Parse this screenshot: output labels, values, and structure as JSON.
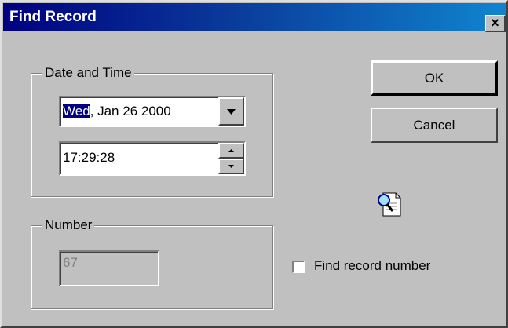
{
  "window": {
    "title": "Find Record",
    "close_glyph": "✕"
  },
  "date_time_group": {
    "legend": "Date and Time",
    "date": {
      "weekday_selected": "Wed",
      "rest": ", Jan 26 2000"
    },
    "time": {
      "value": "17:29:28"
    }
  },
  "number_group": {
    "legend": "Number",
    "value": "67",
    "enabled": false
  },
  "buttons": {
    "ok": "OK",
    "cancel": "Cancel"
  },
  "checkbox": {
    "label": "Find record number",
    "checked": false
  },
  "icons": {
    "dropdown": "chevron-down-icon",
    "spin_up": "spin-up-icon",
    "spin_down": "spin-down-icon",
    "find": "find-document-icon"
  }
}
